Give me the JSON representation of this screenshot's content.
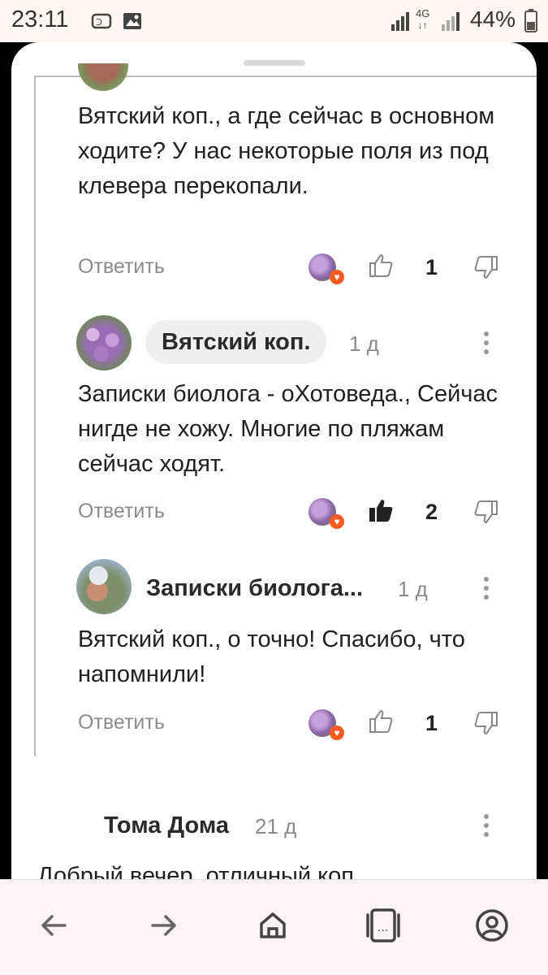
{
  "status_bar": {
    "time": "23:11",
    "network": "4G",
    "battery": "44%"
  },
  "comments": [
    {
      "text": "Вятский коп., а где сейчас в основном ходите? У нас некоторые поля из под клевера перекопали.",
      "reply_label": "Ответить",
      "likes": "1",
      "liked": false
    },
    {
      "author": "Вятский коп.",
      "age": "1 д",
      "text": "Записки биолога - оХотоведа., Сейчас нигде не хожу. Многие по пляжам сейчас ходят.",
      "reply_label": "Ответить",
      "likes": "2",
      "liked": true
    },
    {
      "author": "Записки биолога...",
      "age": "1 д",
      "text": "Вятский коп., о точно! Спасибо, что напомнили!",
      "reply_label": "Ответить",
      "likes": "1",
      "liked": false
    },
    {
      "author": "Тома Дома",
      "age": "21 д",
      "text_cutoff": "Добрый вечер, отличный коп."
    }
  ],
  "colors": {
    "accent_heart": "#ff5a1f",
    "muted_text": "#8b8b8b"
  },
  "nav_icons": [
    "back-arrow-icon",
    "forward-arrow-icon",
    "home-icon",
    "tabs-icon",
    "profile-icon"
  ]
}
